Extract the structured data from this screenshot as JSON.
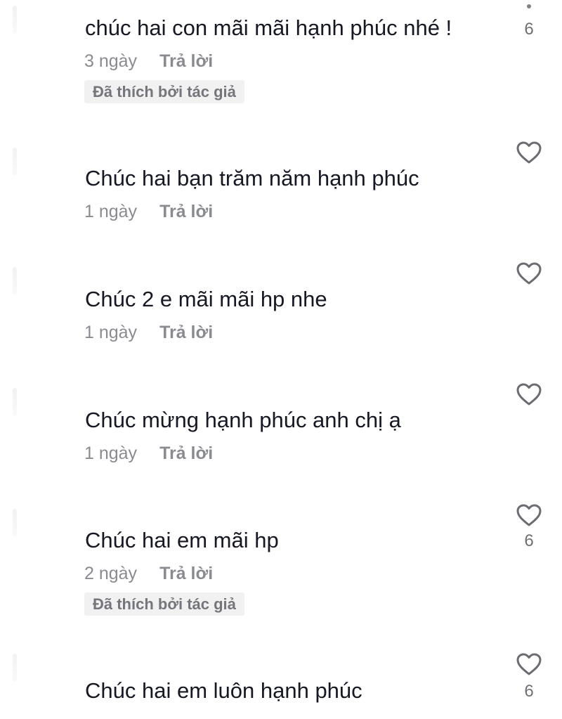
{
  "comments": [
    {
      "text": "chúc hai con mãi mãi hạnh phúc nhé !",
      "time": "3 ngày",
      "reply": "Trả lời",
      "liked_by_author": "Đã thích bởi tác giả",
      "likes": "6"
    },
    {
      "text": "Chúc hai bạn trăm năm hạnh phúc",
      "time": "1 ngày",
      "reply": "Trả lời"
    },
    {
      "text": "Chúc 2 e mãi mãi hp nhe",
      "time": "1 ngày",
      "reply": "Trả lời"
    },
    {
      "text": "Chúc mừng hạnh phúc anh chị ạ",
      "time": "1 ngày",
      "reply": "Trả lời"
    },
    {
      "text": "Chúc hai em mãi hp",
      "time": "2 ngày",
      "reply": "Trả lời",
      "liked_by_author": "Đã thích bởi tác giả",
      "likes": "6"
    },
    {
      "text": "Chúc hai em luôn hạnh phúc",
      "likes": "6"
    }
  ],
  "icons": {
    "like": "heart-outline-icon"
  },
  "colors": {
    "primary_text": "#161823",
    "secondary_text": "#8a8b91",
    "badge_bg": "#f1f1f2"
  }
}
